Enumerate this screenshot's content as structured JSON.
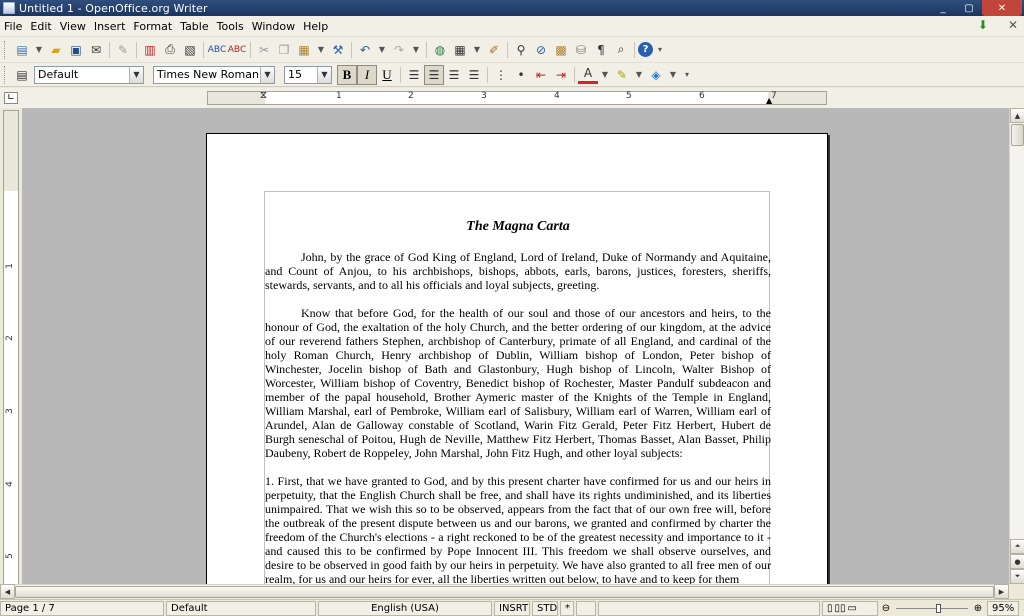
{
  "window": {
    "title": "Untitled 1 - OpenOffice.org Writer",
    "controls": [
      "_",
      "▢",
      "✕"
    ]
  },
  "menubar": {
    "items": [
      "File",
      "Edit",
      "View",
      "Insert",
      "Format",
      "Table",
      "Tools",
      "Window",
      "Help"
    ]
  },
  "formatting": {
    "style": "Default",
    "font": "Times New Roman",
    "size": "15"
  },
  "ruler": {
    "numbers": [
      "1",
      "2",
      "3",
      "4",
      "5",
      "6",
      "7"
    ],
    "vertical_numbers": [
      "1",
      "2",
      "3",
      "4",
      "5"
    ]
  },
  "document": {
    "title": "The Magna Carta",
    "paragraphs": [
      "John, by the grace of God King of England, Lord of Ireland, Duke of Normandy and Aquitaine, and Count of Anjou, to his archbishops, bishops, abbots, earls, barons, justices, foresters, sheriffs, stewards, servants, and to all his officials and loyal subjects, greeting.",
      "Know that before God, for the health of our soul and those of our ancestors and heirs, to the honour of God, the exaltation of the holy Church, and the better ordering of our kingdom, at the advice of our reverend fathers Stephen, archbishop of Canterbury, primate of all England, and cardinal of the holy Roman Church, Henry archbishop of Dublin, William bishop of London, Peter bishop of Winchester, Jocelin bishop of Bath and Glastonbury, Hugh bishop of Lincoln, Walter Bishop of Worcester, William bishop of Coventry, Benedict bishop of Rochester, Master Pandulf subdeacon and member of the papal household, Brother Aymeric master of the Knights of the Temple in England, William Marshal, earl of Pembroke, William earl of Salisbury, William earl of Warren, William earl of Arundel, Alan de Galloway constable of Scotland, Warin Fitz Gerald, Peter Fitz Herbert, Hubert de Burgh seneschal of Poitou, Hugh de Neville, Matthew Fitz Herbert, Thomas Basset, Alan Basset, Philip Daubeny, Robert de Roppeley, John Marshal, John Fitz Hugh, and other loyal subjects:",
      "1. First, that we have granted to God, and by this present charter have confirmed for us and our heirs in perpetuity, that the English Church shall be free, and shall have its rights undiminished, and its liberties unimpaired. That we wish this so to be observed, appears from the fact that of our own free will, before the outbreak of the present dispute between us and our barons, we granted and confirmed by charter the freedom of the Church's elections - a right reckoned to be of the greatest necessity and importance to it - and caused this to be confirmed by Pope Innocent III. This freedom we shall observe ourselves, and desire to be observed in good faith by our heirs in perpetuity. We have also granted to all free men of our realm, for us and our heirs for ever, all the liberties written out below, to have and to keep for them"
    ]
  },
  "statusbar": {
    "page": "Page 1 / 7",
    "page_style": "Default",
    "language": "English (USA)",
    "insert_mode": "INSRT",
    "selection_mode": "STD",
    "modified": "*",
    "zoom": "95%",
    "zoom_fraction": 0.6
  }
}
